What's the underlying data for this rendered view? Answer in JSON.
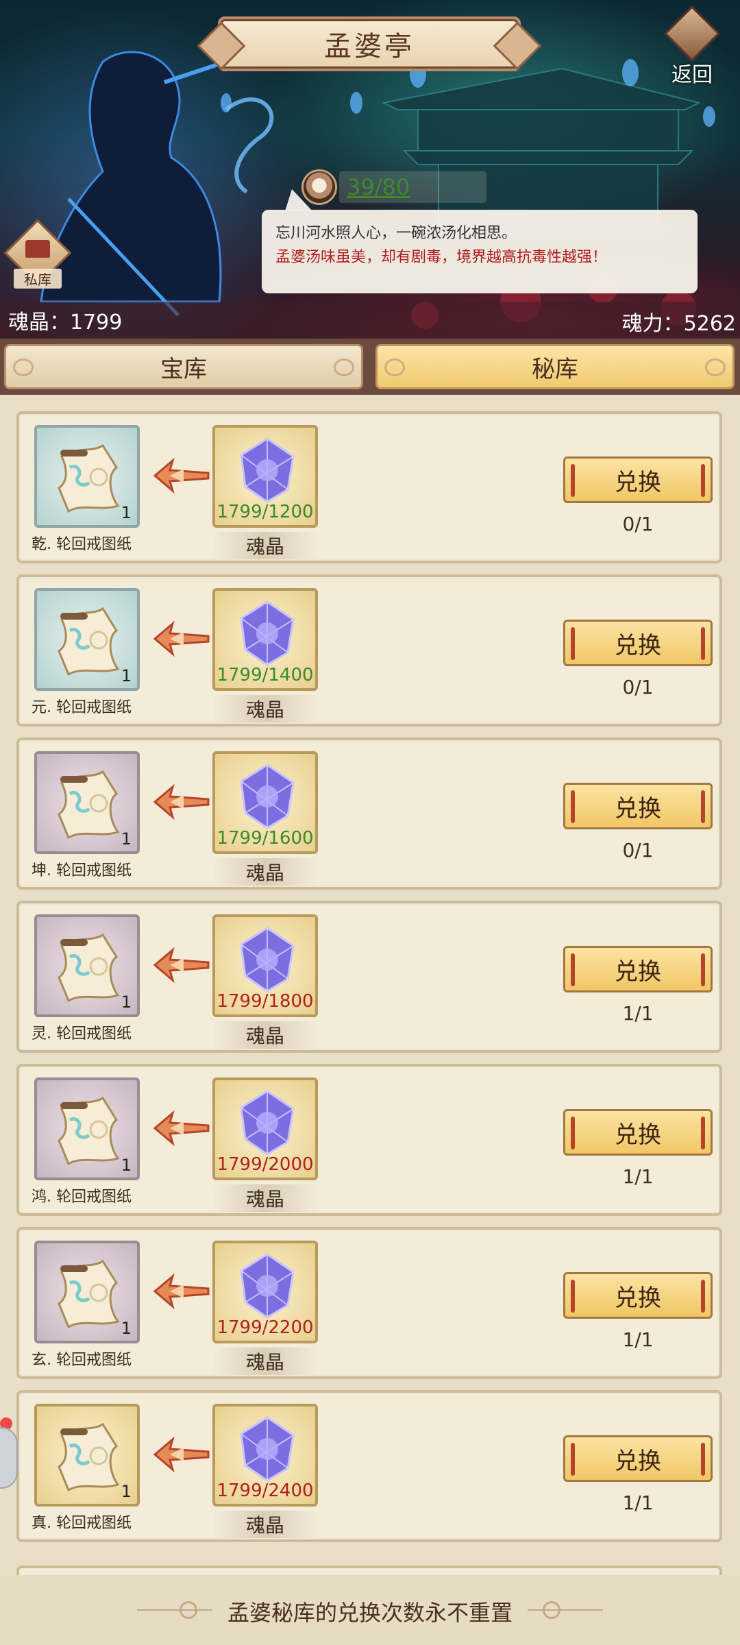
{
  "header": {
    "title": "孟婆亭",
    "back_label": "返回",
    "private_label": "私库",
    "counter": "39/80",
    "dialogue_line1": "忘川河水照人心，一碗浓汤化相思。",
    "dialogue_line2": "孟婆汤味虽美，却有剧毒，境界越高抗毒性越强！",
    "soul_crystal": "魂晶：1799",
    "soul_power": "魂力：5262"
  },
  "tabs": {
    "treasury": "宝库",
    "secret": "秘库",
    "active": "秘库"
  },
  "rows": [
    {
      "reward_name": "乾. 轮回戒图纸",
      "reward_count": "1",
      "reward_tier": "teal",
      "cost_count": "1799/1200",
      "cost_ok": true,
      "cost_name": "魂晶",
      "button": "兑换",
      "limit": "0/1"
    },
    {
      "reward_name": "元. 轮回戒图纸",
      "reward_count": "1",
      "reward_tier": "teal",
      "cost_count": "1799/1400",
      "cost_ok": true,
      "cost_name": "魂晶",
      "button": "兑换",
      "limit": "0/1"
    },
    {
      "reward_name": "坤. 轮回戒图纸",
      "reward_count": "1",
      "reward_tier": "purple",
      "cost_count": "1799/1600",
      "cost_ok": true,
      "cost_name": "魂晶",
      "button": "兑换",
      "limit": "0/1"
    },
    {
      "reward_name": "灵. 轮回戒图纸",
      "reward_count": "1",
      "reward_tier": "purple",
      "cost_count": "1799/1800",
      "cost_ok": false,
      "cost_name": "魂晶",
      "button": "兑换",
      "limit": "1/1"
    },
    {
      "reward_name": "鸿. 轮回戒图纸",
      "reward_count": "1",
      "reward_tier": "purple",
      "cost_count": "1799/2000",
      "cost_ok": false,
      "cost_name": "魂晶",
      "button": "兑换",
      "limit": "1/1"
    },
    {
      "reward_name": "玄. 轮回戒图纸",
      "reward_count": "1",
      "reward_tier": "purple",
      "cost_count": "1799/2200",
      "cost_ok": false,
      "cost_name": "魂晶",
      "button": "兑换",
      "limit": "1/1"
    },
    {
      "reward_name": "真. 轮回戒图纸",
      "reward_count": "1",
      "reward_tier": "gold",
      "cost_count": "1799/2400",
      "cost_ok": false,
      "cost_name": "魂晶",
      "button": "兑换",
      "limit": "1/1"
    }
  ],
  "footer": {
    "note": "孟婆秘库的兑换次数永不重置"
  },
  "icons": {
    "back": "back-arrow-icon",
    "bowl": "soup-bowl-icon",
    "private": "private-vault-icon",
    "reward": "scroll-blueprint-icon",
    "cost": "soul-crystal-icon",
    "arrow": "exchange-arrow-icon"
  },
  "colors": {
    "cost_ok": "#3c8a2a",
    "cost_insufficient": "#b11f1f",
    "counter": "#3d8a2e",
    "dialogue_warning": "#b01b1b",
    "button_fill": "#f1c766"
  }
}
